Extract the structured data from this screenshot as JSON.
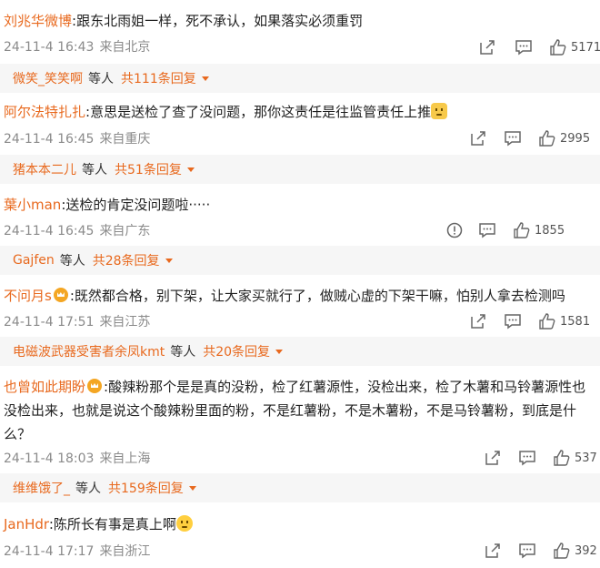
{
  "comments": [
    {
      "user": "刘兆华微博",
      "text": ":跟东北雨姐一样，死不承认，如果落实必须重罚",
      "date": "24-11-4 16:43",
      "loc": "来自北京",
      "likes": "5171",
      "reply": {
        "name": "微笑_笑笑啊",
        "suffix": "等人",
        "count": "共111条回复"
      },
      "icons": [
        "share-icon",
        "comment-icon",
        "like-icon"
      ]
    },
    {
      "user": "阿尔法特扎扎",
      "text": ":意思是送检了查了没问题，那你这责任是往监管责任上推",
      "date": "24-11-4 16:45",
      "loc": "来自重庆",
      "likes": "2995",
      "reply": {
        "name": "猪本本二儿",
        "suffix": "等人",
        "count": "共51条回复"
      },
      "icons": [
        "share-icon",
        "comment-icon",
        "like-icon"
      ]
    },
    {
      "user": "葉小man",
      "text": ":送检的肯定没问题啦·····",
      "date": "24-11-4 16:45",
      "loc": "来自广东",
      "likes": "1855",
      "reply": {
        "name": "Gajfen",
        "suffix": "等人",
        "count": "共28条回复"
      },
      "icons": [
        "report-icon",
        "comment-icon",
        "like-icon"
      ]
    },
    {
      "user": "不问月s",
      "text": ":既然都合格，别下架，让大家买就行了，做贼心虚的下架干嘛，怕别人拿去检测吗",
      "date": "24-11-4 17:51",
      "loc": "来自江苏",
      "likes": "1581",
      "reply": {
        "name": "电磁波武器受害者余凤kmt",
        "suffix": "等人",
        "count": "共20条回复"
      },
      "icons": [
        "share-icon",
        "comment-icon",
        "like-icon"
      ]
    },
    {
      "user": "也曾如此期盼",
      "text": ":酸辣粉那个是是真的没粉，检了红薯源性，没检出来，检了木薯和马铃薯源性也没检出来，也就是说这个酸辣粉里面的粉，不是红薯粉，不是木薯粉，不是马铃薯粉，到底是什么？",
      "date": "24-11-4 18:03",
      "loc": "来自上海",
      "likes": "537",
      "reply": {
        "name": "维维饿了_",
        "suffix": "等人",
        "count": "共159条回复"
      },
      "icons": [
        "share-icon",
        "comment-icon",
        "like-icon"
      ]
    },
    {
      "user": "JanHdr",
      "text": ":陈所长有事是真上啊",
      "date": "24-11-4 17:17",
      "loc": "来自浙江",
      "likes": "392",
      "reply": null,
      "icons": [
        "share-icon",
        "comment-icon",
        "like-icon"
      ]
    }
  ]
}
